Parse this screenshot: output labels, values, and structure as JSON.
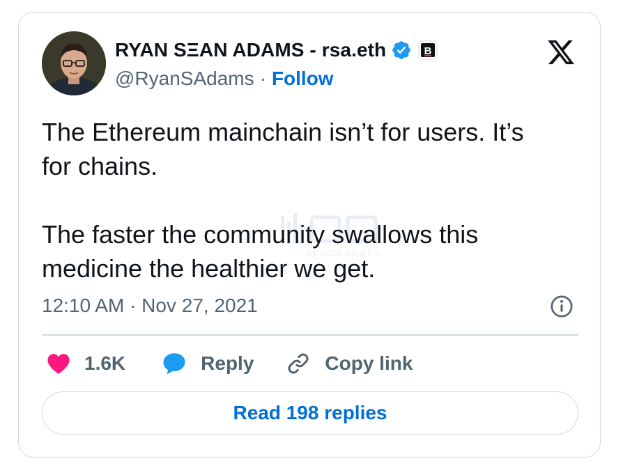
{
  "tweet": {
    "author_name": "RYAN SΞAN ADAMS - rsa.eth",
    "handle": "@RyanSAdams",
    "separator": "·",
    "follow_label": "Follow",
    "affiliate_badge_letter": "B",
    "text": "The Ethereum mainchain isn’t for users. It’s\nfor chains.\n\nThe faster the community swallows this\nmedicine the healthier we get.",
    "timestamp": "12:10 AM · Nov 27, 2021"
  },
  "actions": {
    "like_count": "1.6K",
    "reply_label": "Reply",
    "copy_link_label": "Copy link"
  },
  "read_replies_label": "Read 198 replies",
  "watermark_text": "BLOCKBEATS",
  "icons": {
    "verified": "verified-badge-icon",
    "affiliate": "affiliate-badge-icon",
    "x_logo": "x-logo-icon",
    "info": "info-icon",
    "heart": "heart-icon",
    "reply": "reply-bubble-icon",
    "link": "link-icon"
  },
  "colors": {
    "text_primary": "#0f1419",
    "text_secondary": "#536471",
    "accent_blue": "#006fd6",
    "verified_blue": "#1d9bf0",
    "like_pink": "#f91880",
    "border": "#cfd9de"
  }
}
